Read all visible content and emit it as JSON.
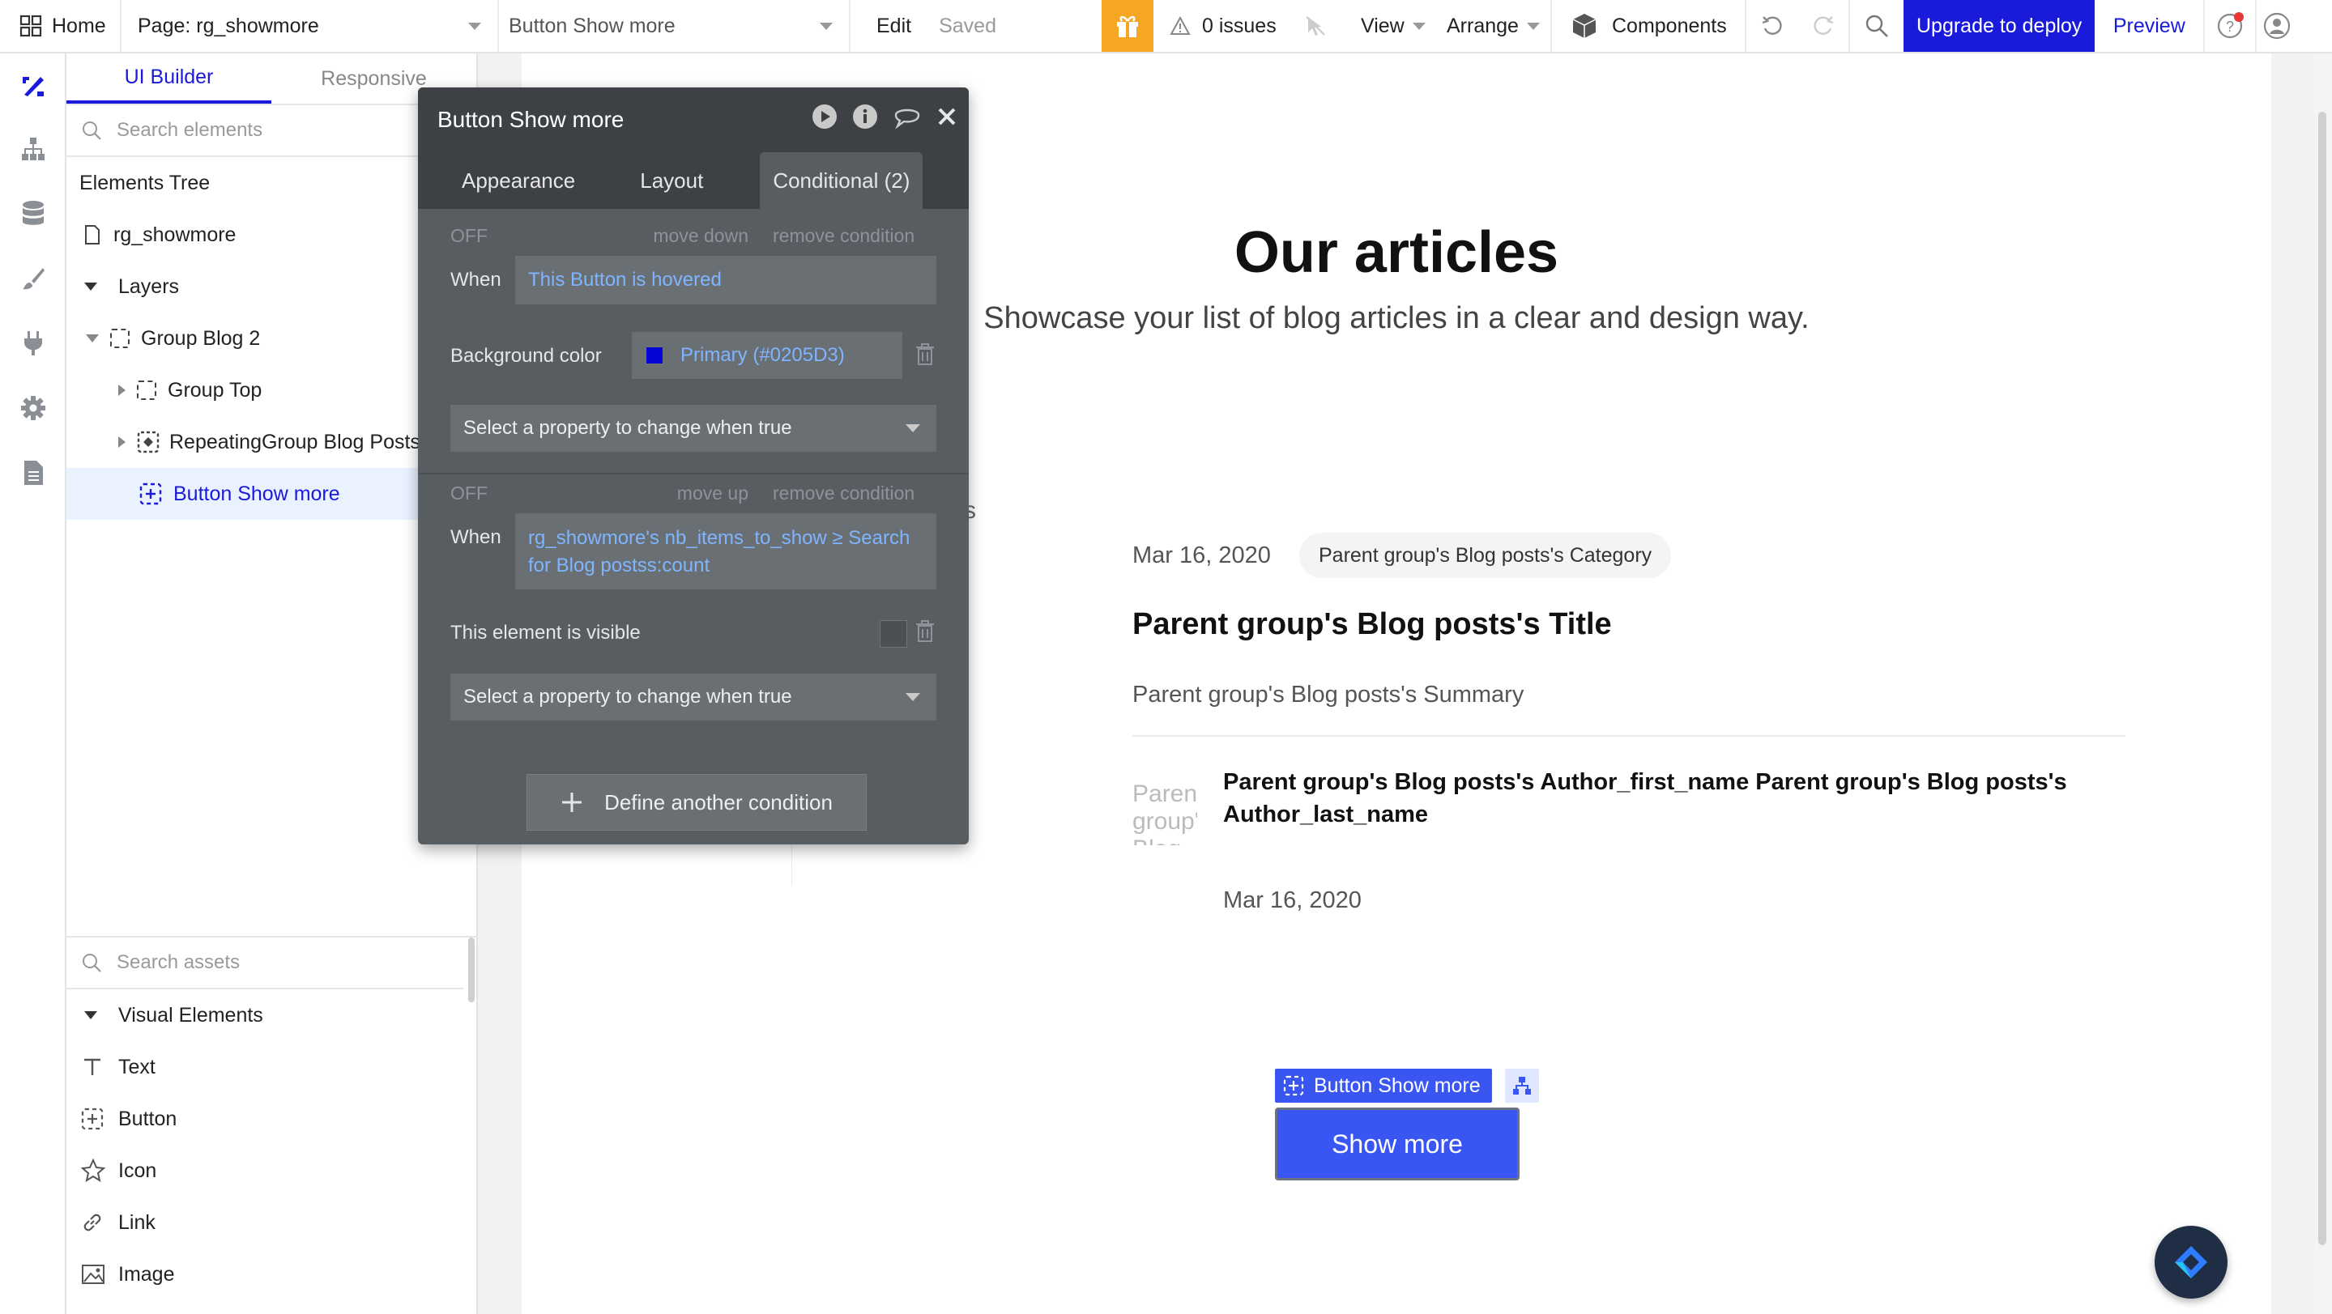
{
  "topbar": {
    "home": "Home",
    "page": "Page: rg_showmore",
    "element": "Button Show more",
    "edit": "Edit",
    "saved": "Saved",
    "issues": "0 issues",
    "view": "View",
    "arrange": "Arrange",
    "components": "Components",
    "upgrade": "Upgrade to deploy",
    "preview": "Preview"
  },
  "side": {
    "tabs": [
      "UI Builder",
      "Responsive"
    ],
    "search_elements": "Search elements",
    "tree_title": "Elements Tree",
    "tree": {
      "page": "rg_showmore",
      "layers": "Layers",
      "group_blog": "Group Blog 2",
      "group_top": "Group Top",
      "repeating": "RepeatingGroup Blog Posts",
      "button": "Button Show more"
    },
    "search_assets": "Search assets",
    "visual_title": "Visual Elements",
    "visual": [
      "Text",
      "Button",
      "Icon",
      "Link",
      "Image"
    ]
  },
  "popup": {
    "title": "Button Show more",
    "tabs": [
      "Appearance",
      "Layout",
      "Conditional (2)"
    ],
    "cond1": {
      "off": "OFF",
      "move": "move down",
      "remove": "remove condition",
      "when_label": "When",
      "when": "This Button is hovered",
      "prop_label": "Background color",
      "prop_value": "Primary (#0205D3)",
      "select": "Select a property to change when true"
    },
    "cond2": {
      "off": "OFF",
      "move": "move up",
      "remove": "remove condition",
      "when_label": "When",
      "when_line1": "rg_showmore's nb_items_to_show ≥ Search",
      "when_line2": "for Blog postss:count",
      "prop_label": "This element is visible",
      "select": "Select a property to change when true"
    },
    "define": "Define another condition"
  },
  "canvas": {
    "heading": "Our articles",
    "sub": "Showcase your list of blog articles in a clear and design way.",
    "stray_s": "s",
    "date": "Mar 16, 2020",
    "category": "Parent group's Blog posts's Category",
    "post_title": "Parent group's Blog posts's Title",
    "summary": "Parent group's Blog posts's Summary",
    "author_line1": "Parent group's Blog posts's Author_first_name Parent group's Blog posts's",
    "author_line2": "Author_last_name",
    "author_date": "Mar 16, 2020",
    "avatar_text": "Parent group's Blog",
    "selected_label": "Button Show more",
    "button": "Show more"
  },
  "colors": {
    "primary": "#0205D3",
    "button": "#3a56f2",
    "accent": "#1a1adb",
    "gift": "#f5a623"
  },
  "icons": [
    "grid-icon",
    "gift-icon",
    "warning-icon",
    "pointer-off-icon",
    "cube-icon",
    "undo-icon",
    "redo-icon",
    "search-icon",
    "help-icon",
    "profile-icon",
    "design-icon",
    "hierarchy-icon",
    "database-icon",
    "brush-icon",
    "plug-icon",
    "settings-icon",
    "document-icon",
    "eye-icon",
    "play-icon",
    "info-icon",
    "comment-icon",
    "close-icon",
    "trash-icon",
    "plus-icon",
    "text-icon",
    "button-icon",
    "star-icon",
    "link-icon",
    "image-icon",
    "logo-icon"
  ]
}
